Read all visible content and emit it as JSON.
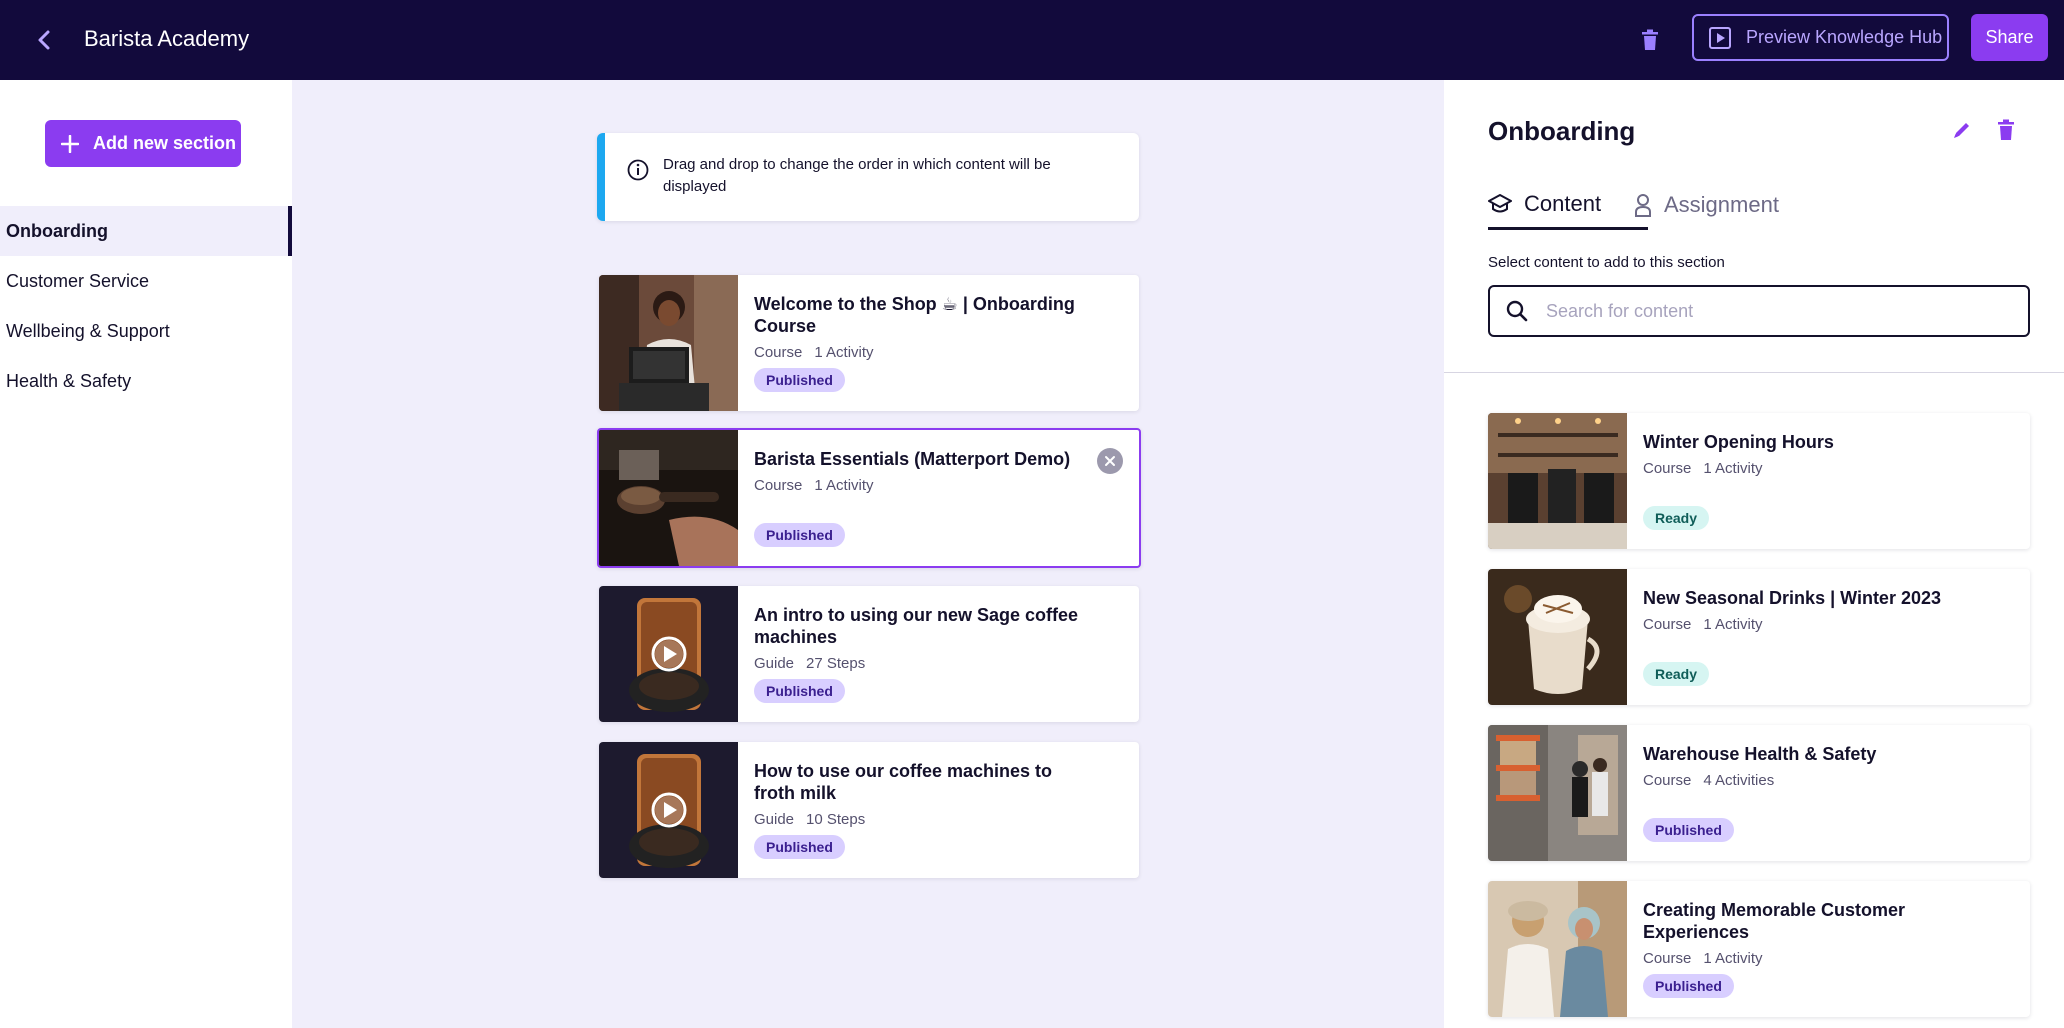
{
  "header": {
    "title": "Barista Academy",
    "preview_label": "Preview Knowledge Hub",
    "share_label": "Share"
  },
  "sidebar": {
    "add_section_label": "Add new section",
    "sections": [
      {
        "label": "Onboarding",
        "active": true
      },
      {
        "label": "Customer Service",
        "active": false
      },
      {
        "label": "Wellbeing & Support",
        "active": false
      },
      {
        "label": "Health & Safety",
        "active": false
      }
    ]
  },
  "main": {
    "info_text": "Drag and drop to change the order in which content will be displayed",
    "items": [
      {
        "title": "Welcome to the Shop ☕ | Onboarding Course",
        "type": "Course",
        "count": "1 Activity",
        "status": "Published"
      },
      {
        "title": "Barista Essentials (Matterport Demo)",
        "type": "Course",
        "count": "1 Activity",
        "status": "Published"
      },
      {
        "title": "An intro to using our new Sage coffee machines",
        "type": "Guide",
        "count": "27 Steps",
        "status": "Published"
      },
      {
        "title": "How to use our coffee machines to froth milk",
        "type": "Guide",
        "count": "10 Steps",
        "status": "Published"
      }
    ]
  },
  "panel": {
    "title": "Onboarding",
    "tabs": [
      {
        "label": "Content"
      },
      {
        "label": "Assignment"
      }
    ],
    "select_label": "Select content to add to this section",
    "search_placeholder": "Search for content",
    "items": [
      {
        "title": "Winter Opening Hours",
        "type": "Course",
        "count": "1 Activity",
        "status": "Ready"
      },
      {
        "title": "New Seasonal Drinks | Winter 2023",
        "type": "Course",
        "count": "1 Activity",
        "status": "Ready"
      },
      {
        "title": "Warehouse Health & Safety",
        "type": "Course",
        "count": "4 Activities",
        "status": "Published"
      },
      {
        "title": "Creating Memorable Customer Experiences",
        "type": "Course",
        "count": "1 Activity",
        "status": "Published"
      }
    ]
  },
  "colors": {
    "topbar": "#120a3c",
    "accent": "#8b3cf0",
    "info_border": "#1da8f0",
    "published_bg": "#d8ceff",
    "ready_bg": "#d6f5f2"
  },
  "icons": {
    "back": "chevron-left-icon",
    "delete": "trash-icon",
    "preview": "play-square-icon",
    "add": "plus-icon",
    "info": "info-circle-icon",
    "edit": "pencil-icon",
    "content_tab": "graduation-cap-icon",
    "assignment_tab": "person-icon",
    "search": "search-icon",
    "remove": "close-circle-icon"
  }
}
